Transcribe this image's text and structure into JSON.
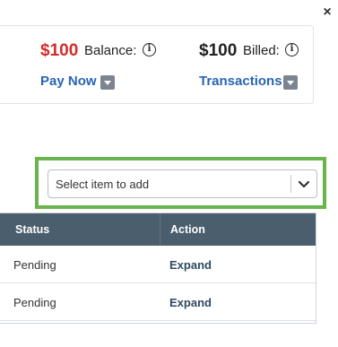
{
  "close": {
    "glyph": "×"
  },
  "balance_card": {
    "balance": {
      "amount": "$100",
      "label": "Balance:",
      "action": "Pay Now"
    },
    "billed": {
      "amount": "$100",
      "label": "Billed:",
      "action": "Transactions"
    },
    "info_glyph": "i"
  },
  "add_select": {
    "placeholder": "Select item to add"
  },
  "table": {
    "headers": [
      "Status",
      "Action"
    ],
    "rows": [
      {
        "status": "Pending",
        "action": "Expand"
      },
      {
        "status": "Pending",
        "action": "Expand"
      }
    ]
  },
  "colors": {
    "accent_red": "#d42b2b",
    "link_blue": "#2865b3",
    "highlight_green": "#6ab44d",
    "header_bg": "#4b5e6d"
  }
}
